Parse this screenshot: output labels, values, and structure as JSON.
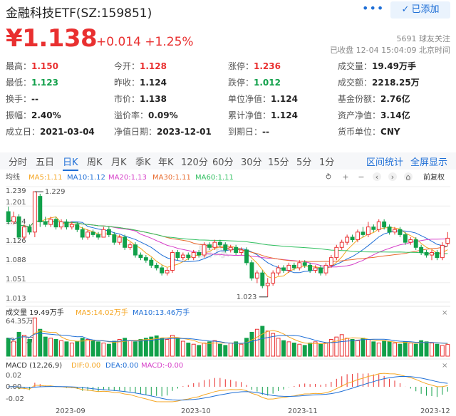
{
  "header": {
    "title": "金融科技ETF(SZ:159851)",
    "more_label": "•••",
    "follow_label": "已添加",
    "price": "¥1.138",
    "change": "+0.014 +1.25%",
    "followers": "5691 球友关注",
    "status": "已收盘 12-04 15:04:09 北京时间"
  },
  "quote": {
    "row1": [
      {
        "label": "最高：",
        "value": "1.150",
        "tone": "red"
      },
      {
        "label": "今开：",
        "value": "1.128",
        "tone": "red"
      },
      {
        "label": "涨停：",
        "value": "1.236",
        "tone": "red"
      },
      {
        "label": "成交量：",
        "value": "19.49万手",
        "tone": ""
      }
    ],
    "row2": [
      {
        "label": "最低：",
        "value": "1.123",
        "tone": "green"
      },
      {
        "label": "昨收：",
        "value": "1.124",
        "tone": ""
      },
      {
        "label": "跌停：",
        "value": "1.012",
        "tone": "green"
      },
      {
        "label": "成交额：",
        "value": "2218.25万",
        "tone": ""
      }
    ],
    "row3": [
      {
        "label": "换手：",
        "value": "--",
        "tone": ""
      },
      {
        "label": "市价：",
        "value": "1.138",
        "tone": ""
      },
      {
        "label": "单位净值：",
        "value": "1.124",
        "tone": ""
      },
      {
        "label": "基金份额：",
        "value": "2.76亿",
        "tone": ""
      }
    ],
    "row4": [
      {
        "label": "振幅：",
        "value": "2.40%",
        "tone": ""
      },
      {
        "label": "溢价率：",
        "value": "0.09%",
        "tone": ""
      },
      {
        "label": "累计净值：",
        "value": "1.124",
        "tone": ""
      },
      {
        "label": "资产净值：",
        "value": "3.14亿",
        "tone": ""
      }
    ],
    "row5": [
      {
        "label": "成立日：",
        "value": "2021-03-04",
        "tone": ""
      },
      {
        "label": "净值日期：",
        "value": "2023-12-01",
        "tone": ""
      },
      {
        "label": "到期日：",
        "value": "--",
        "tone": ""
      },
      {
        "label": "货币单位：",
        "value": "CNY",
        "tone": ""
      }
    ]
  },
  "tabs": {
    "periods": [
      "分时",
      "五日",
      "日K",
      "周K",
      "月K",
      "季K",
      "年K",
      "120分",
      "60分",
      "30分",
      "15分",
      "5分",
      "1分"
    ],
    "active": "日K",
    "interval_stats": "区间统计",
    "fullscreen": "全屏显示"
  },
  "kline": {
    "ma_legend": [
      {
        "label": "均线",
        "color": "#555555"
      },
      {
        "label": "MA5:1.11",
        "color": "#f5a623"
      },
      {
        "label": "MA10:1.12",
        "color": "#1f6fd6"
      },
      {
        "label": "MA20:1.13",
        "color": "#d63ec8"
      },
      {
        "label": "MA30:1.11",
        "color": "#e86a2c"
      },
      {
        "label": "MA60:1.11",
        "color": "#2fbf5f"
      }
    ],
    "fuquan_label": "前复权",
    "y_ticks": [
      "1.239",
      "1.201",
      "1.164",
      "1.126",
      "1.088",
      "1.051",
      "1.013"
    ],
    "max_label": "1.229",
    "min_label": "1.023",
    "colors": {
      "up": "#e93030",
      "down": "#11a04a"
    }
  },
  "volume": {
    "title": "成交量 19.49万手",
    "ma5": "MA5:14.02万手",
    "ma10": "MA10:13.46万手",
    "y_ticks": [
      "64.35万",
      "32.18万"
    ]
  },
  "macd": {
    "title": "MACD (12,26,9)",
    "dif": "DIF:0.00",
    "dea": "DEA:0.00",
    "macd": "MACD:-0.00",
    "y_ticks": [
      "0.02",
      "0.00",
      "-0.02"
    ],
    "x_labels": [
      "2023-09",
      "2023-10",
      "2023-11",
      "2023-12"
    ]
  },
  "chart_data": {
    "type": "candlestick",
    "symbol": "SZ:159851",
    "period": "日K",
    "ylim": [
      1.013,
      1.239
    ],
    "max_marker": 1.229,
    "min_marker": 1.023,
    "x_labels": [
      "2023-09",
      "2023-10",
      "2023-11",
      "2023-12"
    ],
    "candles": [
      [
        1.19,
        1.17,
        1.2,
        1.165
      ],
      [
        1.17,
        1.18,
        1.19,
        1.165
      ],
      [
        1.18,
        1.14,
        1.185,
        1.135
      ],
      [
        1.14,
        1.16,
        1.165,
        1.135
      ],
      [
        1.16,
        1.15,
        1.165,
        1.145
      ],
      [
        1.15,
        1.229,
        1.229,
        1.14
      ],
      [
        1.22,
        1.17,
        1.225,
        1.16
      ],
      [
        1.17,
        1.165,
        1.18,
        1.16
      ],
      [
        1.165,
        1.175,
        1.18,
        1.16
      ],
      [
        1.175,
        1.16,
        1.18,
        1.155
      ],
      [
        1.16,
        1.17,
        1.175,
        1.155
      ],
      [
        1.17,
        1.16,
        1.175,
        1.155
      ],
      [
        1.16,
        1.165,
        1.17,
        1.155
      ],
      [
        1.165,
        1.155,
        1.17,
        1.15
      ],
      [
        1.155,
        1.14,
        1.16,
        1.135
      ],
      [
        1.14,
        1.15,
        1.155,
        1.135
      ],
      [
        1.15,
        1.145,
        1.155,
        1.14
      ],
      [
        1.145,
        1.14,
        1.15,
        1.135
      ],
      [
        1.14,
        1.155,
        1.16,
        1.14
      ],
      [
        1.155,
        1.145,
        1.16,
        1.14
      ],
      [
        1.145,
        1.13,
        1.15,
        1.125
      ],
      [
        1.13,
        1.14,
        1.145,
        1.125
      ],
      [
        1.14,
        1.12,
        1.145,
        1.115
      ],
      [
        1.12,
        1.125,
        1.13,
        1.115
      ],
      [
        1.125,
        1.105,
        1.13,
        1.1
      ],
      [
        1.105,
        1.1,
        1.11,
        1.095
      ],
      [
        1.1,
        1.095,
        1.105,
        1.09
      ],
      [
        1.095,
        1.085,
        1.1,
        1.08
      ],
      [
        1.085,
        1.08,
        1.09,
        1.075
      ],
      [
        1.08,
        1.07,
        1.085,
        1.065
      ],
      [
        1.07,
        1.075,
        1.08,
        1.065
      ],
      [
        1.075,
        1.11,
        1.115,
        1.07
      ],
      [
        1.11,
        1.1,
        1.115,
        1.095
      ],
      [
        1.1,
        1.105,
        1.11,
        1.095
      ],
      [
        1.105,
        1.1,
        1.11,
        1.095
      ],
      [
        1.1,
        1.11,
        1.115,
        1.095
      ],
      [
        1.11,
        1.105,
        1.115,
        1.1
      ],
      [
        1.105,
        1.125,
        1.13,
        1.1
      ],
      [
        1.125,
        1.12,
        1.13,
        1.115
      ],
      [
        1.12,
        1.13,
        1.135,
        1.115
      ],
      [
        1.13,
        1.125,
        1.135,
        1.12
      ],
      [
        1.125,
        1.115,
        1.13,
        1.11
      ],
      [
        1.115,
        1.12,
        1.125,
        1.11
      ],
      [
        1.12,
        1.11,
        1.125,
        1.105
      ],
      [
        1.11,
        1.115,
        1.12,
        1.105
      ],
      [
        1.115,
        1.09,
        1.12,
        1.085
      ],
      [
        1.09,
        1.06,
        1.095,
        1.055
      ],
      [
        1.06,
        1.07,
        1.075,
        1.05
      ],
      [
        1.07,
        1.045,
        1.075,
        1.04
      ],
      [
        1.045,
        1.05,
        1.06,
        1.023
      ],
      [
        1.05,
        1.07,
        1.075,
        1.045
      ],
      [
        1.07,
        1.08,
        1.085,
        1.065
      ],
      [
        1.08,
        1.075,
        1.085,
        1.07
      ],
      [
        1.075,
        1.085,
        1.09,
        1.07
      ],
      [
        1.085,
        1.08,
        1.09,
        1.075
      ],
      [
        1.08,
        1.09,
        1.095,
        1.075
      ],
      [
        1.09,
        1.085,
        1.095,
        1.08
      ],
      [
        1.085,
        1.075,
        1.09,
        1.07
      ],
      [
        1.075,
        1.08,
        1.085,
        1.07
      ],
      [
        1.08,
        1.07,
        1.085,
        1.065
      ],
      [
        1.07,
        1.085,
        1.09,
        1.065
      ],
      [
        1.085,
        1.1,
        1.105,
        1.08
      ],
      [
        1.1,
        1.12,
        1.125,
        1.095
      ],
      [
        1.12,
        1.13,
        1.135,
        1.115
      ],
      [
        1.13,
        1.14,
        1.145,
        1.125
      ],
      [
        1.14,
        1.135,
        1.145,
        1.13
      ],
      [
        1.135,
        1.15,
        1.155,
        1.13
      ],
      [
        1.15,
        1.145,
        1.16,
        1.14
      ],
      [
        1.145,
        1.16,
        1.17,
        1.14
      ],
      [
        1.16,
        1.155,
        1.165,
        1.15
      ],
      [
        1.155,
        1.17,
        1.175,
        1.15
      ],
      [
        1.17,
        1.16,
        1.175,
        1.155
      ],
      [
        1.16,
        1.15,
        1.165,
        1.145
      ],
      [
        1.15,
        1.155,
        1.16,
        1.145
      ],
      [
        1.155,
        1.145,
        1.16,
        1.14
      ],
      [
        1.145,
        1.13,
        1.15,
        1.125
      ],
      [
        1.13,
        1.135,
        1.14,
        1.125
      ],
      [
        1.135,
        1.12,
        1.14,
        1.115
      ],
      [
        1.12,
        1.11,
        1.125,
        1.105
      ],
      [
        1.11,
        1.105,
        1.115,
        1.1
      ],
      [
        1.105,
        1.11,
        1.115,
        1.095
      ],
      [
        1.11,
        1.1,
        1.115,
        1.095
      ],
      [
        1.1,
        1.124,
        1.13,
        1.095
      ],
      [
        1.128,
        1.138,
        1.15,
        1.123
      ]
    ],
    "volume": [
      30,
      25,
      40,
      35,
      28,
      64,
      45,
      32,
      30,
      28,
      26,
      24,
      22,
      25,
      30,
      28,
      26,
      24,
      22,
      20,
      25,
      28,
      30,
      26,
      24,
      28,
      30,
      32,
      34,
      30,
      28,
      35,
      30,
      25,
      22,
      20,
      18,
      22,
      24,
      26,
      20,
      18,
      22,
      24,
      20,
      30,
      40,
      45,
      50,
      42,
      38,
      30,
      26,
      24,
      22,
      20,
      18,
      22,
      24,
      20,
      22,
      28,
      32,
      36,
      30,
      28,
      26,
      30,
      28,
      24,
      22,
      26,
      24,
      22,
      20,
      24,
      22,
      20,
      26,
      24,
      22,
      20,
      18,
      19.5
    ],
    "volume_ylim": [
      0,
      64.35
    ],
    "volume_unit": "万手",
    "macd_ylim": [
      -0.02,
      0.02
    ],
    "ma_current": {
      "MA5": 1.11,
      "MA10": 1.12,
      "MA20": 1.13,
      "MA30": 1.11,
      "MA60": 1.11
    },
    "volume_ma": {
      "MA5": 14.02,
      "MA10": 13.46
    },
    "macd_values": {
      "DIF": 0.0,
      "DEA": 0.0,
      "MACD": -0.0
    }
  }
}
